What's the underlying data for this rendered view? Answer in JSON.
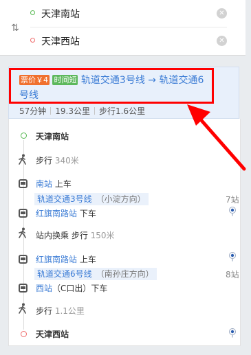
{
  "search": {
    "from": "天津南站",
    "to": "天津西站"
  },
  "plan": {
    "price_tag": "票价￥4",
    "time_tag": "时间短",
    "route": "轨道交通3号线 → 轨道交通6号线",
    "duration": "57分钟",
    "distance": "19.3公里",
    "walk": "步行1.6公里"
  },
  "steps": {
    "start": "天津南站",
    "walk1": "步行",
    "walk1_dist": "340米",
    "board1_station": "南站",
    "board1_action": "上车",
    "line1": "轨道交通3号线",
    "line1_dir": "（小淀方向）",
    "line1_count": "7站",
    "alight1_station": "红旗南路站",
    "alight1_action": "下车",
    "transfer": "站内换乘 步行",
    "transfer_dist": "150米",
    "board2_station": "红旗南路站",
    "board2_action": "上车",
    "line2": "轨道交通6号线",
    "line2_dir": "（南孙庄方向）",
    "line2_count": "8站",
    "alight2_station": "西站",
    "alight2_exit": "（C口出）",
    "alight2_action": "下车",
    "walk2": "步行",
    "walk2_dist": "1.1公里",
    "end": "天津西站"
  },
  "colors": {
    "accent_blue": "#3a7bd5",
    "price_tag": "#f0702e",
    "time_tag": "#5cb85c",
    "annotation_red": "#ff0000"
  }
}
